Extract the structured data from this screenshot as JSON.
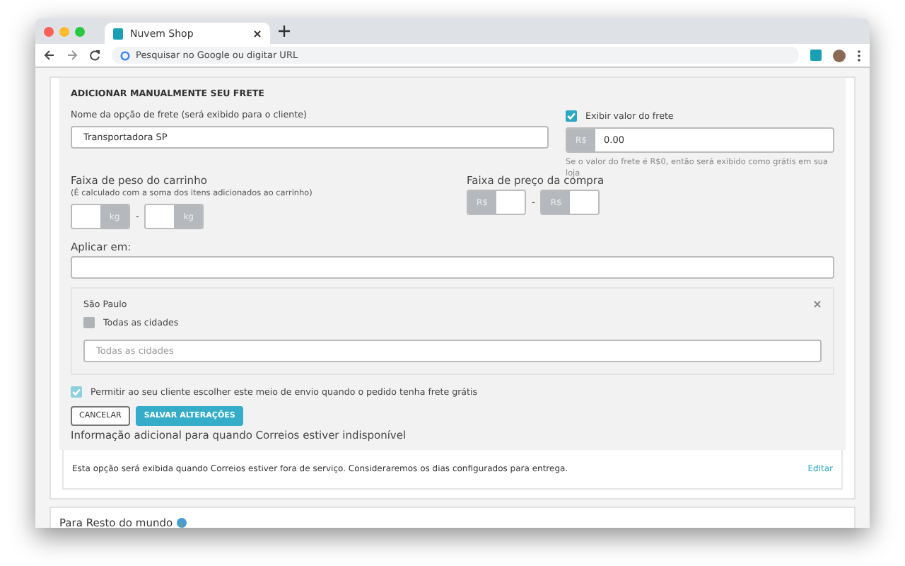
{
  "browser": {
    "tab_title": "Nuvem Shop",
    "address_placeholder": "Pesquisar no Google ou digitar URL"
  },
  "form": {
    "heading": "ADICIONAR MANUALMENTE SEU FRETE",
    "name_label": "Nome da opção de frete (será exibido para o cliente)",
    "name_value": "Transportadora SP",
    "show_price": {
      "label": "Exibir valor do frete",
      "checked": true
    },
    "price": {
      "prefix": "R$",
      "value": "0.00",
      "hint": "Se o valor do frete é R$0, então será exibido como grátis em sua loja"
    },
    "weight": {
      "label": "Faixa de peso do carrinho",
      "hint": "(É calculado com a soma dos itens adicionados ao carrinho)",
      "units": [
        "kg",
        "kg"
      ],
      "separator": "-"
    },
    "purchase": {
      "label": "Faixa de preço da compra",
      "prefixes": [
        "R$",
        "R$"
      ],
      "separator": "-"
    },
    "apply_label": "Aplicar em:",
    "region": {
      "name": "São Paulo",
      "all_cities": {
        "label": "Todas as cidades",
        "checked": false
      },
      "cities_placeholder": "Todas as cidades"
    },
    "free_shipping": {
      "label": "Permitir ao seu cliente escolher este meio de envio quando o pedido tenha frete grátis",
      "checked": true
    },
    "buttons": [
      {
        "label": "CANCELAR",
        "kind": "secondary"
      },
      {
        "label": "SALVAR ALTERAÇÕES",
        "kind": "primary"
      }
    ],
    "info_title": "Informação adicional para quando Correios estiver indisponível",
    "info_text": "Esta opção será exibida quando Correios estiver fora de serviço. Consideraremos os dias configurados para entrega.",
    "edit_link": "Editar"
  },
  "next_section": {
    "title": "Para Resto do mundo"
  }
}
